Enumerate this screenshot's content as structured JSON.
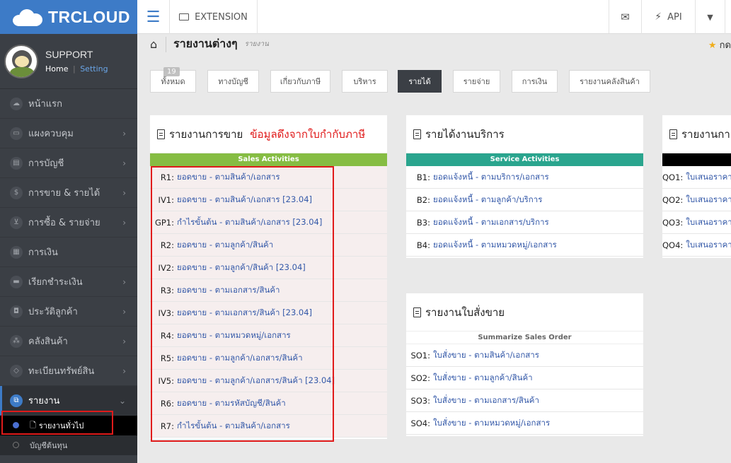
{
  "brand": {
    "name": "TRCLOUD"
  },
  "profile": {
    "name": "SUPPORT",
    "home": "Home",
    "separator": "|",
    "setting": "Setting"
  },
  "sidebar": {
    "items": [
      {
        "label": "หน้าแรก",
        "icon": "cloud-icon",
        "chevron": false
      },
      {
        "label": "แผงควบคุม",
        "icon": "monitor-icon",
        "chevron": true
      },
      {
        "label": "การบัญชี",
        "icon": "book-icon",
        "chevron": true
      },
      {
        "label": "การขาย & รายได้",
        "icon": "dollar-icon",
        "chevron": true
      },
      {
        "label": "การซื้อ & รายจ่าย",
        "icon": "cart-icon",
        "chevron": true
      },
      {
        "label": "การเงิน",
        "icon": "calendar-icon",
        "chevron": false
      },
      {
        "label": "เรียกชำระเงิน",
        "icon": "card-icon",
        "chevron": true
      },
      {
        "label": "ประวัติลูกค้า",
        "icon": "contact-icon",
        "chevron": true
      },
      {
        "label": "คลังสินค้า",
        "icon": "cubes-icon",
        "chevron": true
      },
      {
        "label": "ทะเบียนทรัพย์สิน",
        "icon": "diamond-icon",
        "chevron": true
      },
      {
        "label": "รายงาน",
        "icon": "report-icon",
        "chevron": true
      }
    ],
    "sub_items": [
      {
        "label": "รายงานทั่วไป"
      },
      {
        "label": "บัญชีต้นทุน"
      }
    ]
  },
  "topbar": {
    "extension": "EXTENSION",
    "api": "API"
  },
  "breadcrumb": {
    "title": "รายงานต่างๆ",
    "sub": "รายงาน"
  },
  "favorite": {
    "label": "กด"
  },
  "filters": [
    {
      "label": "ทั้งหมด",
      "badge": "19"
    },
    {
      "label": "ทางบัญชี"
    },
    {
      "label": "เกี่ยวกับภาษี"
    },
    {
      "label": "บริหาร"
    },
    {
      "label": "รายได้"
    },
    {
      "label": "รายจ่าย"
    },
    {
      "label": "การเงิน"
    },
    {
      "label": "รายงานคลังสินค้า"
    }
  ],
  "panels": {
    "sales": {
      "title": "รายงานการขาย",
      "note": "ข้อมูลดึงจากใบกำกับภาษี",
      "band": "Sales Activities",
      "rows": [
        {
          "code": "R1:",
          "text": "ยอดขาย - ตามสินค้า/เอกสาร"
        },
        {
          "code": "IV1:",
          "text": "ยอดขาย - ตามสินค้า/เอกสาร [23.04]"
        },
        {
          "code": "GP1:",
          "text": "กำไรขั้นต้น - ตามสินค้า/เอกสาร [23.04]"
        },
        {
          "code": "R2:",
          "text": "ยอดขาย - ตามลูกค้า/สินค้า"
        },
        {
          "code": "IV2:",
          "text": "ยอดขาย - ตามลูกค้า/สินค้า [23.04]"
        },
        {
          "code": "R3:",
          "text": "ยอดขาย - ตามเอกสาร/สินค้า"
        },
        {
          "code": "IV3:",
          "text": "ยอดขาย - ตามเอกสาร/สินค้า [23.04]"
        },
        {
          "code": "R4:",
          "text": "ยอดขาย - ตามหมวดหมู่/เอกสาร"
        },
        {
          "code": "R5:",
          "text": "ยอดขาย - ตามลูกค้า/เอกสาร/สินค้า"
        },
        {
          "code": "IV5:",
          "text": "ยอดขาย - ตามลูกค้า/เอกสาร/สินค้า [23.04]"
        },
        {
          "code": "R6:",
          "text": "ยอดขาย - ตามรหัสบัญชี/สินค้า"
        },
        {
          "code": "R7:",
          "text": "กำไรขั้นต้น - ตามสินค้า/เอกสาร"
        }
      ]
    },
    "service": {
      "title": "รายได้งานบริการ",
      "band": "Service Activities",
      "rows": [
        {
          "code": "B1:",
          "text": "ยอดแจ้งหนี้ - ตามบริการ/เอกสาร"
        },
        {
          "code": "B2:",
          "text": "ยอดแจ้งหนี้ - ตามลูกค้า/บริการ"
        },
        {
          "code": "B3:",
          "text": "ยอดแจ้งหนี้ - ตามเอกสาร/บริการ"
        },
        {
          "code": "B4:",
          "text": "ยอดแจ้งหนี้ - ตามหมวดหมู่/เอกสาร"
        }
      ]
    },
    "salesorder": {
      "title": "รายงานใบสั่งขาย",
      "band": "Summarize Sales Order",
      "rows": [
        {
          "code": "SO1:",
          "text": "ใบสั่งขาย - ตามสินค้า/เอกสาร"
        },
        {
          "code": "SO2:",
          "text": "ใบสั่งขาย - ตามลูกค้า/สินค้า"
        },
        {
          "code": "SO3:",
          "text": "ใบสั่งขาย - ตามเอกสาร/สินค้า"
        },
        {
          "code": "SO4:",
          "text": "ใบสั่งขาย - ตามหมวดหมู่/เอกสาร"
        }
      ]
    },
    "quote": {
      "title": "รายงานกา",
      "rows": [
        {
          "code": "QO1:",
          "text": "ใบเสนอราคา"
        },
        {
          "code": "QO2:",
          "text": "ใบเสนอราคา"
        },
        {
          "code": "QO3:",
          "text": "ใบเสนอราคา"
        },
        {
          "code": "QO4:",
          "text": "ใบเสนอราคา"
        }
      ]
    }
  }
}
